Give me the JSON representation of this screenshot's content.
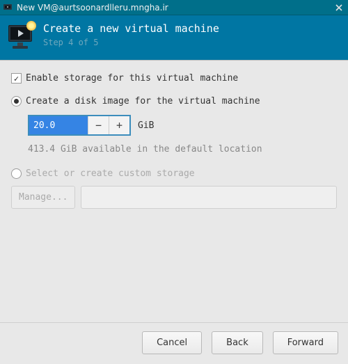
{
  "window": {
    "title": "New VM@aurtsoonardlleru.mngha.ir"
  },
  "header": {
    "title": "Create a new virtual machine",
    "step": "Step 4 of 5"
  },
  "storage": {
    "enable_label": "Enable storage for this virtual machine",
    "enable_checked": true,
    "create_disk_label": "Create a disk image for the virtual machine",
    "create_disk_selected": true,
    "size_value": "20.0",
    "size_unit": "GiB",
    "available_hint": "413.4 GiB available in the default location",
    "custom_label": "Select or create custom storage",
    "custom_selected": false,
    "manage_label": "Manage...",
    "custom_path": ""
  },
  "footer": {
    "cancel": "Cancel",
    "back": "Back",
    "forward": "Forward"
  }
}
